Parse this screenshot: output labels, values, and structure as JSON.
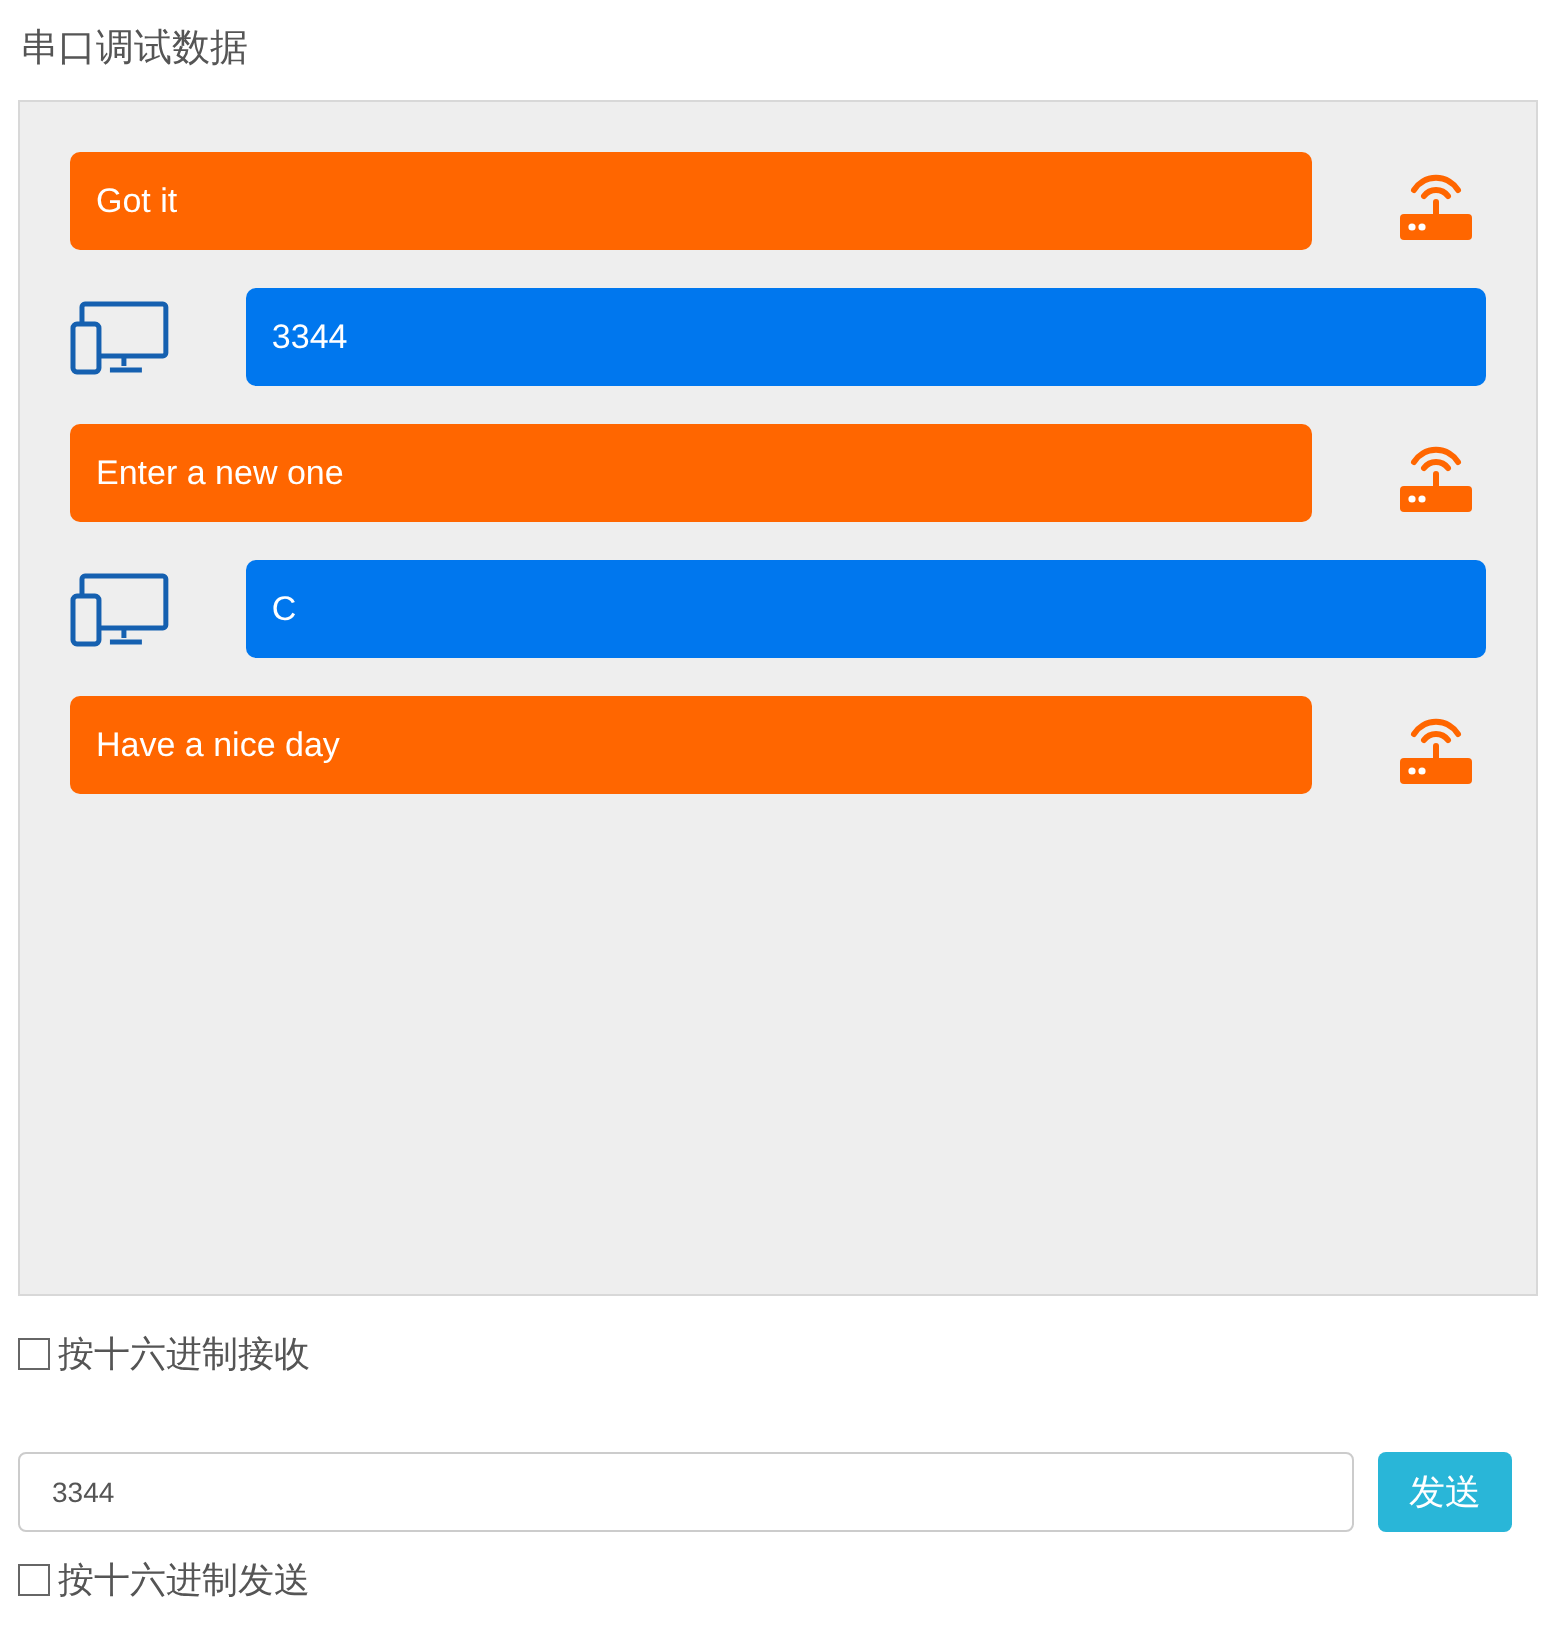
{
  "title": "串口调试数据",
  "messages": [
    {
      "kind": "received",
      "text": "Got it"
    },
    {
      "kind": "sent",
      "text": "3344"
    },
    {
      "kind": "received",
      "text": "Enter a new one"
    },
    {
      "kind": "sent",
      "text": "C"
    },
    {
      "kind": "received",
      "text": "Have a nice day"
    }
  ],
  "hex_receive": {
    "label": "按十六进制接收",
    "checked": false
  },
  "send_field": {
    "value": "3344"
  },
  "send_button": "发送",
  "hex_send": {
    "label": "按十六进制发送",
    "checked": false
  }
}
